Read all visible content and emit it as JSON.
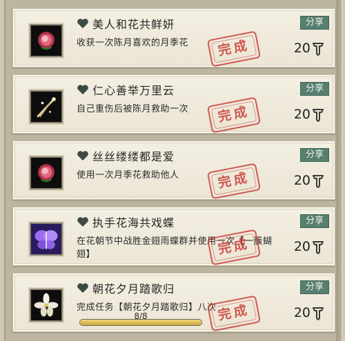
{
  "stamp_text": "完成",
  "share_label": "分享",
  "achievements": [
    {
      "title": "美人和花共鲜妍",
      "desc": "收获一次陈月喜欢的月季花",
      "points": "20",
      "icon": "rose-icon"
    },
    {
      "title": "仁心善举万里云",
      "desc": "自己重伤后被陈月救助一次",
      "points": "20",
      "icon": "sparkle-sword-icon"
    },
    {
      "title": "丝丝缕缕都是爱",
      "desc": "使用一次月季花救助他人",
      "points": "20",
      "icon": "rose-icon"
    },
    {
      "title": "执手花海共戏蝶",
      "desc": "在花朝节中战胜金翅雨蝶群并使用一次【一簇蝴翅】",
      "points": "20",
      "icon": "purple-butterfly-icon"
    },
    {
      "title": "朝花夕月踏歌归",
      "desc": "完成任务【朝花夕月踏歌归】八次",
      "points": "20",
      "icon": "white-flower-icon",
      "progress_text": "8/8",
      "progress": 1.0
    }
  ],
  "colors": {
    "share_bg": "#567f70",
    "stamp": "#c8342f",
    "progress_fill": "#d9bd55"
  }
}
